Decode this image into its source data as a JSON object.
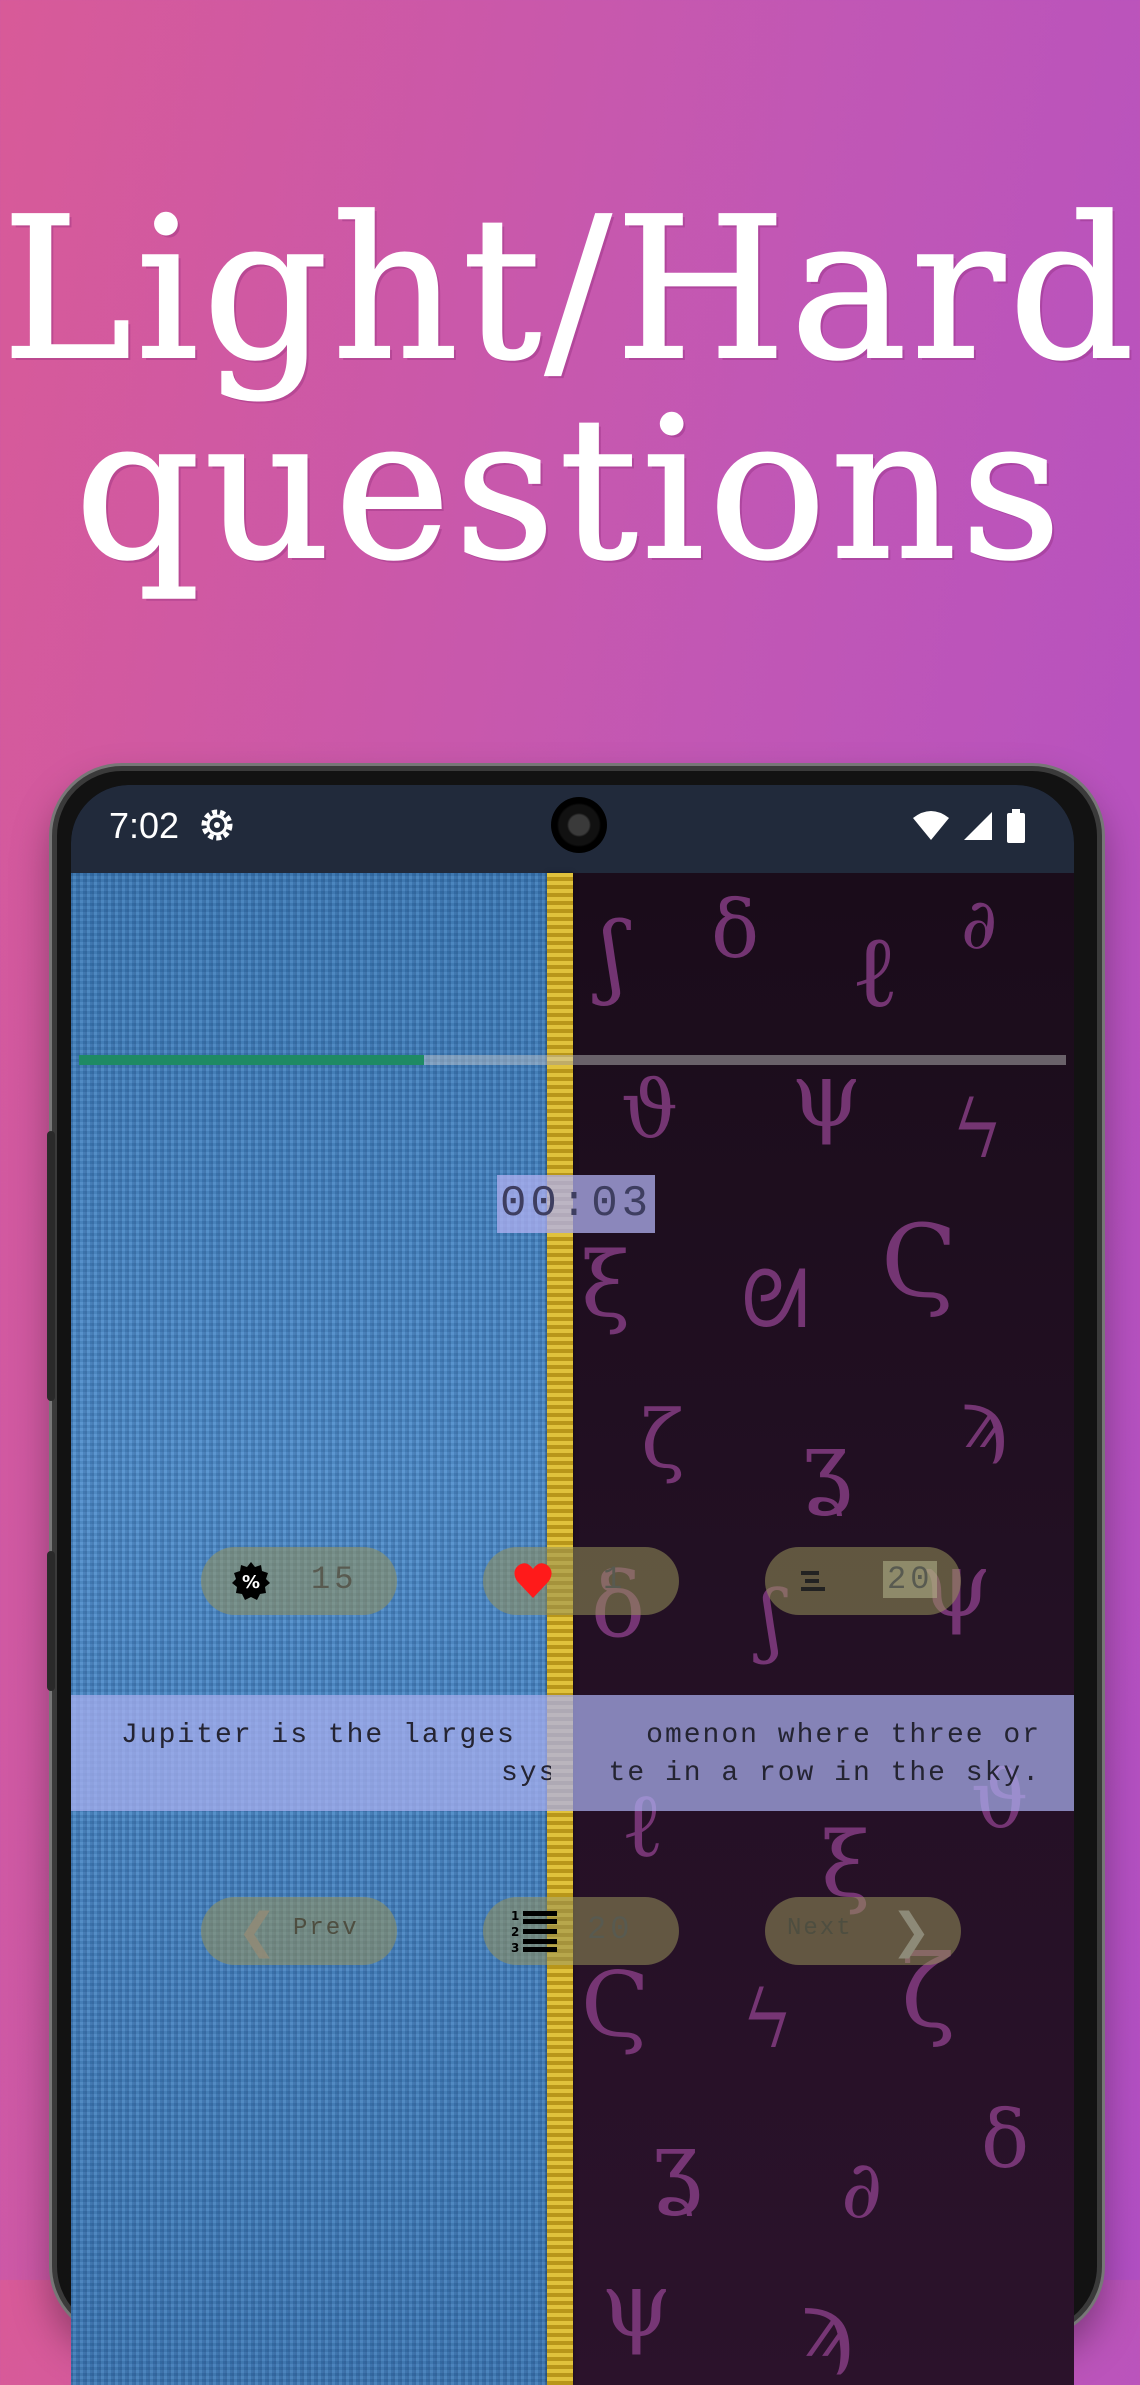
{
  "promo": {
    "line1": "Light/Hard",
    "line2": "questions"
  },
  "status_bar": {
    "time": "7:02",
    "icons": [
      "gear-icon",
      "wifi-icon",
      "signal-icon",
      "battery-icon"
    ]
  },
  "quiz": {
    "progress_fraction": 0.35,
    "timer": "00:03",
    "stats": {
      "percent_value": "15",
      "lives_value": "1",
      "total_value": "20"
    },
    "question_left_line1": "Jupiter is the larges",
    "question_left_line2": "sys",
    "question_right_line1": "omenon where three or",
    "question_right_line2": "te in a row in the sky.",
    "nav": {
      "prev_label": "Prev",
      "list_count": "20",
      "next_label": "Next"
    }
  },
  "colors": {
    "background_left": "#d85a98",
    "background_right": "#b24fc4",
    "progress": "#1f8a64",
    "heart": "#ff1a1a",
    "zipper": "#d0b030"
  }
}
